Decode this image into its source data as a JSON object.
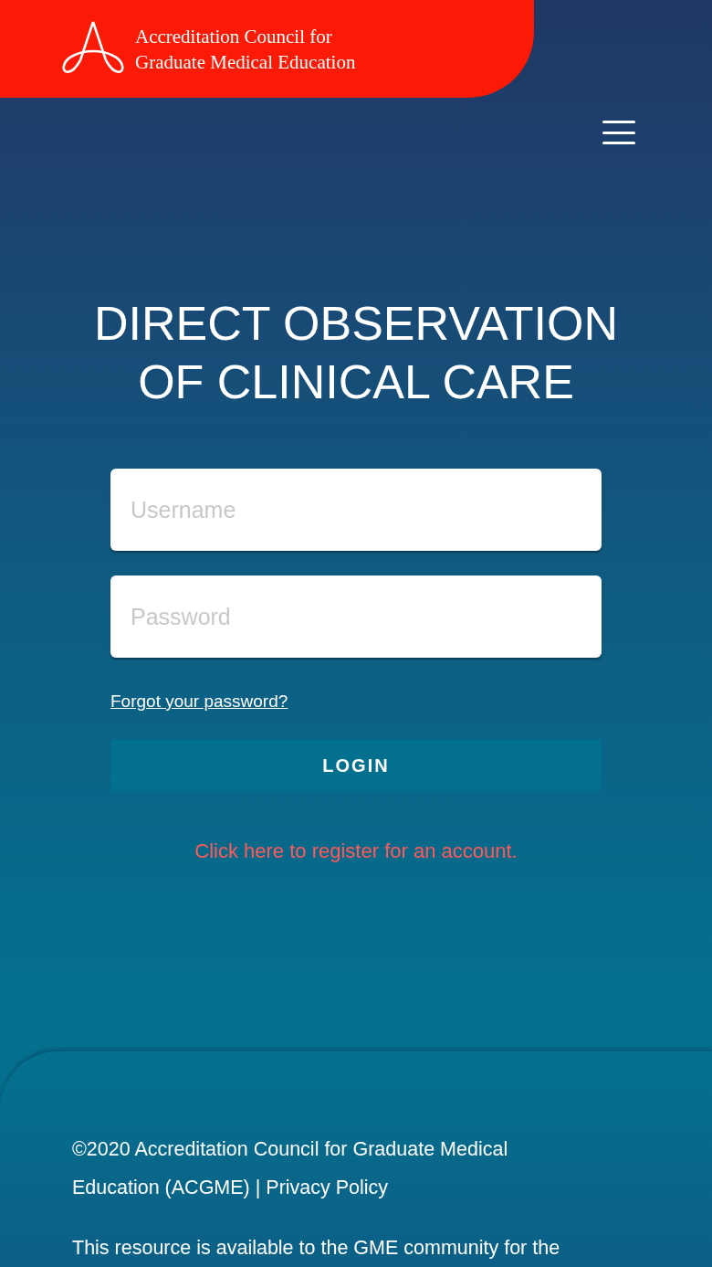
{
  "header": {
    "organization_name": [
      "Accreditation Council for",
      "Graduate Medical Education"
    ]
  },
  "title": "DIRECT OBSERVATION OF CLINICAL CARE",
  "form": {
    "username_field": {
      "placeholder": "Username"
    },
    "password_field": {
      "placeholder": "Password"
    },
    "forgot_link": "Forgot your password?",
    "login_button": "LOGIN",
    "register_link": "Click here to register for an account."
  },
  "footer": {
    "copyright": "©2020 Accreditation Council for Graduate Medical Education (ACGME) | ",
    "privacy_link": "Privacy Policy",
    "notice": "This resource is available to the GME community for the"
  }
}
